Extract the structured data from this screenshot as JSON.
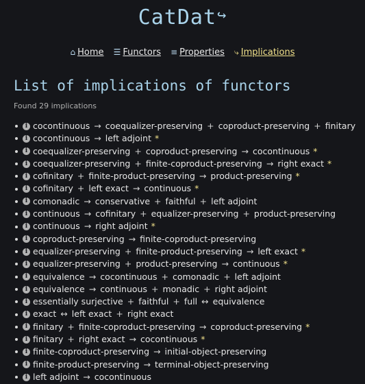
{
  "logo": {
    "text": "CatDat",
    "arrow": "↪"
  },
  "nav": [
    {
      "icon": "⌂",
      "label": "Home"
    },
    {
      "icon": "☰",
      "label": "Functors"
    },
    {
      "icon": "≡",
      "label": "Properties"
    },
    {
      "icon": "⤷",
      "label": "Implications"
    }
  ],
  "page_title": "List of implications of functors",
  "found_text": "Found 29 implications",
  "implications": [
    {
      "text": [
        "cocontinuous",
        "→",
        "coequalizer-preserving",
        "+",
        "coproduct-preserving",
        "+",
        "finitary"
      ],
      "star": ""
    },
    {
      "text": [
        "cocontinuous",
        "→",
        "left adjoint"
      ],
      "star": "*"
    },
    {
      "text": [
        "coequalizer-preserving",
        "+",
        "coproduct-preserving",
        "→",
        "cocontinuous"
      ],
      "star": "*"
    },
    {
      "text": [
        "coequalizer-preserving",
        "+",
        "finite-coproduct-preserving",
        "→",
        "right exact"
      ],
      "star": "*"
    },
    {
      "text": [
        "cofinitary",
        "+",
        "finite-product-preserving",
        "→",
        "product-preserving"
      ],
      "star": "*"
    },
    {
      "text": [
        "cofinitary",
        "+",
        "left exact",
        "→",
        "continuous"
      ],
      "star": "*"
    },
    {
      "text": [
        "comonadic",
        "→",
        "conservative",
        "+",
        "faithful",
        "+",
        "left adjoint"
      ],
      "star": ""
    },
    {
      "text": [
        "continuous",
        "→",
        "cofinitary",
        "+",
        "equalizer-preserving",
        "+",
        "product-preserving"
      ],
      "star": ""
    },
    {
      "text": [
        "continuous",
        "→",
        "right adjoint"
      ],
      "star": "*"
    },
    {
      "text": [
        "coproduct-preserving",
        "→",
        "finite-coproduct-preserving"
      ],
      "star": ""
    },
    {
      "text": [
        "equalizer-preserving",
        "+",
        "finite-product-preserving",
        "→",
        "left exact"
      ],
      "star": "*"
    },
    {
      "text": [
        "equalizer-preserving",
        "+",
        "product-preserving",
        "→",
        "continuous"
      ],
      "star": "*"
    },
    {
      "text": [
        "equivalence",
        "→",
        "cocontinuous",
        "+",
        "comonadic",
        "+",
        "left adjoint"
      ],
      "star": ""
    },
    {
      "text": [
        "equivalence",
        "→",
        "continuous",
        "+",
        "monadic",
        "+",
        "right adjoint"
      ],
      "star": ""
    },
    {
      "text": [
        "essentially surjective",
        "+",
        "faithful",
        "+",
        "full",
        "↔",
        "equivalence"
      ],
      "star": ""
    },
    {
      "text": [
        "exact",
        "↔",
        "left exact",
        "+",
        "right exact"
      ],
      "star": ""
    },
    {
      "text": [
        "finitary",
        "+",
        "finite-coproduct-preserving",
        "→",
        "coproduct-preserving"
      ],
      "star": "*"
    },
    {
      "text": [
        "finitary",
        "+",
        "right exact",
        "→",
        "cocontinuous"
      ],
      "star": "*"
    },
    {
      "text": [
        "finite-coproduct-preserving",
        "→",
        "initial-object-preserving"
      ],
      "star": ""
    },
    {
      "text": [
        "finite-product-preserving",
        "→",
        "terminal-object-preserving"
      ],
      "star": ""
    },
    {
      "text": [
        "left adjoint",
        "→",
        "cocontinuous"
      ],
      "star": ""
    }
  ],
  "colors": {
    "background": "#15161a",
    "accent_blue": "#a9d3ea",
    "active_yellow": "#f0e08a",
    "text": "#e6e6e6"
  },
  "icons": {
    "info": "info-icon",
    "home": "home-icon",
    "functors": "database-icon",
    "properties": "list-icon",
    "implications": "implication-icon"
  }
}
